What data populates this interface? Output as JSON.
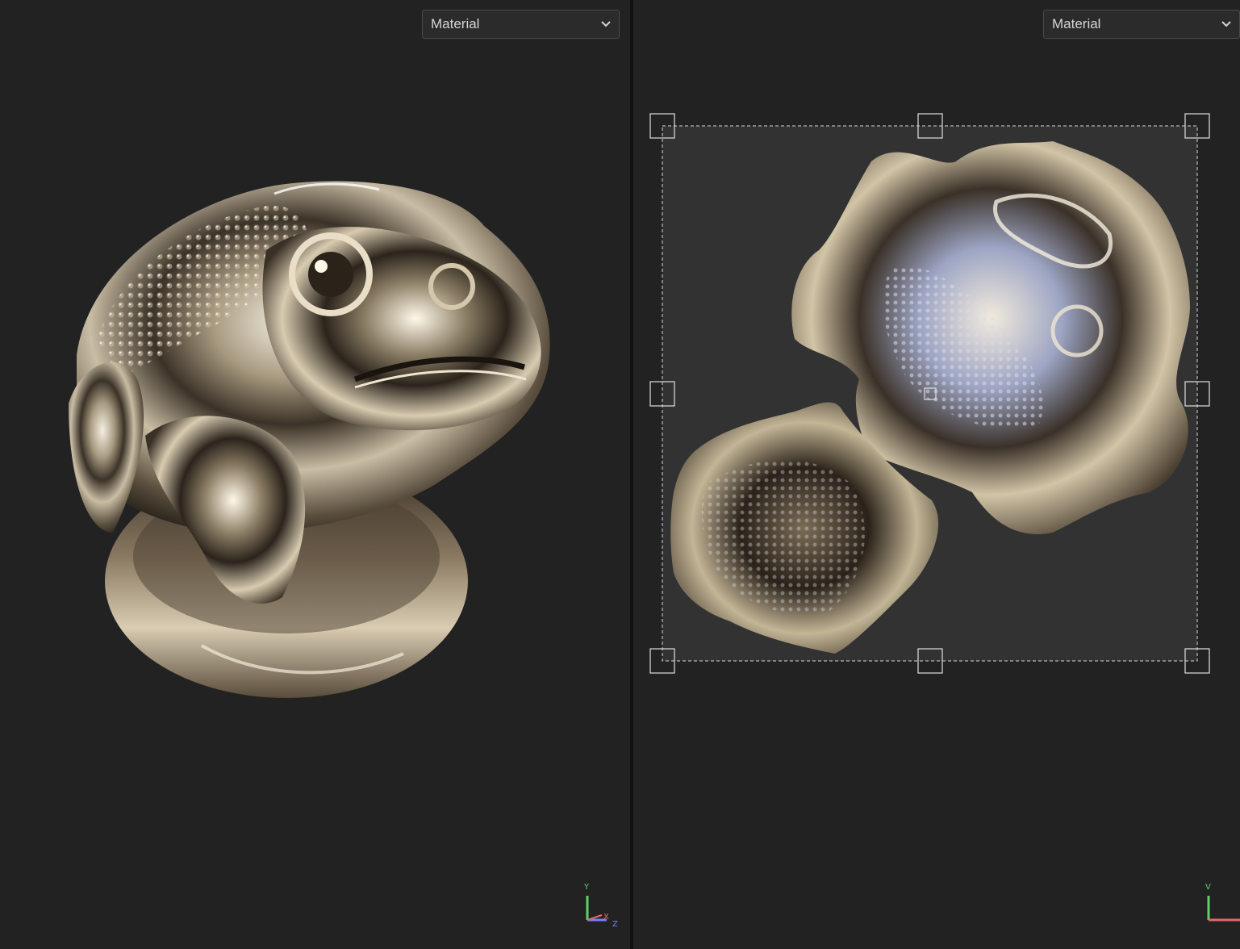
{
  "left_viewport": {
    "mode_dropdown": {
      "selected": "Material"
    },
    "axis_gizmo": {
      "y_label": "Y",
      "x_label": "X",
      "z_label": "Z"
    },
    "model": {
      "description_icon": "chrome-toad-model"
    }
  },
  "right_viewport": {
    "mode_dropdown": {
      "selected": "Material"
    },
    "axis_gizmo": {
      "v_label": "V"
    },
    "uv_islands": {
      "icon": "uv-island-layout"
    }
  },
  "colors": {
    "background": "#222222",
    "splitter": "#121212",
    "uv_canvas": "#323232",
    "dropdown_bg": "#2b2b2b",
    "dropdown_border": "#4a4a4a",
    "axis_y": "#5fd16a",
    "axis_x": "#e06a6a",
    "axis_z": "#7a7ef0"
  }
}
